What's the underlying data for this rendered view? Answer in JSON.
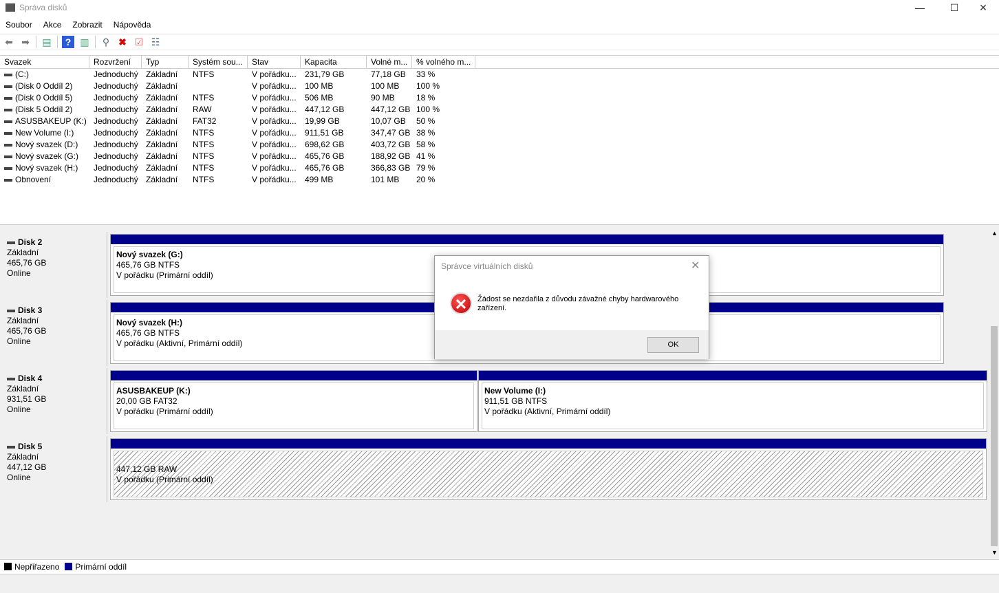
{
  "window": {
    "title": "Správa disků"
  },
  "menu": [
    "Soubor",
    "Akce",
    "Zobrazit",
    "Nápověda"
  ],
  "list": {
    "headers": [
      "Svazek",
      "Rozvržení",
      "Typ",
      "Systém sou...",
      "Stav",
      "Kapacita",
      "Volné m...",
      "% volného m..."
    ],
    "rows": [
      [
        "(C:)",
        "Jednoduchý",
        "Základní",
        "NTFS",
        "V pořádku...",
        "231,79 GB",
        "77,18 GB",
        "33 %"
      ],
      [
        "(Disk 0 Oddíl 2)",
        "Jednoduchý",
        "Základní",
        "",
        "V pořádku...",
        "100 MB",
        "100 MB",
        "100 %"
      ],
      [
        "(Disk 0 Oddíl 5)",
        "Jednoduchý",
        "Základní",
        "NTFS",
        "V pořádku...",
        "506 MB",
        "90 MB",
        "18 %"
      ],
      [
        "(Disk 5 Oddíl 2)",
        "Jednoduchý",
        "Základní",
        "RAW",
        "V pořádku...",
        "447,12 GB",
        "447,12 GB",
        "100 %"
      ],
      [
        "ASUSBAKEUP (K:)",
        "Jednoduchý",
        "Základní",
        "FAT32",
        "V pořádku...",
        "19,99 GB",
        "10,07 GB",
        "50 %"
      ],
      [
        "New Volume (I:)",
        "Jednoduchý",
        "Základní",
        "NTFS",
        "V pořádku...",
        "911,51 GB",
        "347,47 GB",
        "38 %"
      ],
      [
        "Nový svazek (D:)",
        "Jednoduchý",
        "Základní",
        "NTFS",
        "V pořádku...",
        "698,62 GB",
        "403,72 GB",
        "58 %"
      ],
      [
        "Nový svazek (G:)",
        "Jednoduchý",
        "Základní",
        "NTFS",
        "V pořádku...",
        "465,76 GB",
        "188,92 GB",
        "41 %"
      ],
      [
        "Nový svazek (H:)",
        "Jednoduchý",
        "Základní",
        "NTFS",
        "V pořádku...",
        "465,76 GB",
        "366,83 GB",
        "79 %"
      ],
      [
        "Obnovení",
        "Jednoduchý",
        "Základní",
        "NTFS",
        "V pořádku...",
        "499 MB",
        "101 MB",
        "20 %"
      ]
    ]
  },
  "disks": [
    {
      "name": "Disk 2",
      "type": "Základní",
      "size": "465,76 GB",
      "status": "Online",
      "parts": [
        {
          "name": "Nový svazek  (G:)",
          "size": "465,76 GB NTFS",
          "state": "V pořádku (Primární oddíl)"
        }
      ]
    },
    {
      "name": "Disk 3",
      "type": "Základní",
      "size": "465,76 GB",
      "status": "Online",
      "parts": [
        {
          "name": "Nový svazek  (H:)",
          "size": "465,76 GB NTFS",
          "state": "V pořádku (Aktivní, Primární oddíl)"
        }
      ]
    },
    {
      "name": "Disk 4",
      "type": "Základní",
      "size": "931,51 GB",
      "status": "Online",
      "parts": [
        {
          "name": "ASUSBAKEUP  (K:)",
          "size": "20,00 GB FAT32",
          "state": "V pořádku (Primární oddíl)"
        },
        {
          "name": "New Volume  (I:)",
          "size": "911,51 GB NTFS",
          "state": "V pořádku (Aktivní, Primární oddíl)"
        }
      ]
    },
    {
      "name": "Disk 5",
      "type": "Základní",
      "size": "447,12 GB",
      "status": "Online",
      "parts": [
        {
          "name": "",
          "size": "447,12 GB RAW",
          "state": "V pořádku (Primární oddíl)"
        }
      ]
    }
  ],
  "legend": {
    "unallocated": "Nepřiřazeno",
    "primary": "Primární oddíl",
    "colors": {
      "unallocated": "#000000",
      "primary": "#00008b"
    }
  },
  "dialog": {
    "title": "Správce virtuálních disků",
    "message": "Žádost se nezdařila z důvodu závažné chyby hardwarového zařízení.",
    "ok": "OK"
  }
}
